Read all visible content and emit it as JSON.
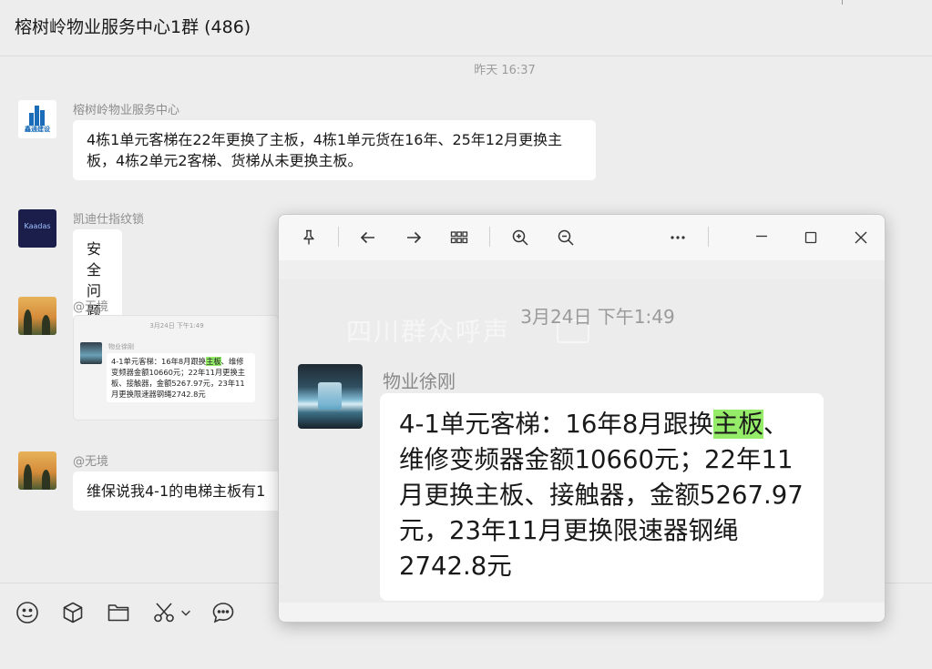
{
  "header": {
    "title": "榕树岭物业服务中心1群 (486)"
  },
  "chat": {
    "timestamp": "昨天 16:37",
    "messages": [
      {
        "sender": "榕树岭物业服务中心",
        "avatar_text": "鑫通建设",
        "text": "4栋1单元客梯在22年更换了主板，4栋1单元货在16年、25年12月更换主板，4栋2单元2客梯、货梯从未更换主板。"
      },
      {
        "sender": "凯迪仕指纹锁",
        "avatar_text": "Kaadas",
        "text": "安全问题怎么解决?"
      },
      {
        "sender": "@无境",
        "type": "image"
      },
      {
        "sender": "@无境",
        "text": "维保说我4-1的电梯主板有1"
      }
    ],
    "thumbnail": {
      "time": "3月24日 下午1:49",
      "name": "物业徐刚",
      "text_before": "4-1单元客梯：16年8月跟换",
      "highlight": "主板",
      "text_after": "、维修变频器金额10660元；22年11月更换主板、接触器，金额5267.97元，23年11月更换限速器钢绳2742.8元"
    }
  },
  "bottom_toolbar": {
    "icons": [
      "emoji-icon",
      "cube-icon",
      "folder-icon",
      "scissors-icon",
      "chevron-down-icon",
      "chat-bubble-icon"
    ]
  },
  "viewer": {
    "timestamp": "3月24日 下午1:49",
    "watermark": "四川群众呼声",
    "sender": "物业徐刚",
    "text_before": "4-1单元客梯：16年8月跟换",
    "highlight": "主板",
    "text_after": "、维修变频器金额10660元；22年11月更换主板、接触器，金额5267.97元，23年11月更换限速器钢绳2742.8元",
    "toolbar_icons": [
      "pin-icon",
      "back-arrow-icon",
      "forward-arrow-icon",
      "grid-icon",
      "zoom-in-icon",
      "zoom-out-icon",
      "more-icon",
      "minimize-icon",
      "maximize-icon",
      "close-icon"
    ]
  },
  "colors": {
    "background": "#ededed",
    "bubble": "#ffffff",
    "highlight": "#95ec69",
    "muted_text": "#9b9b9b"
  }
}
